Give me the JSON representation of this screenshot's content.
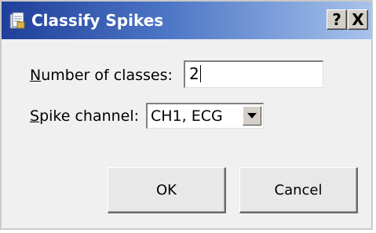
{
  "window": {
    "title": "Classify Spikes",
    "help_label": "?",
    "close_label": "X"
  },
  "form": {
    "classes_label_access": "N",
    "classes_label_rest": "umber of classes:",
    "classes_value": "2",
    "channel_label_access": "S",
    "channel_label_rest": "pike channel:",
    "channel_selected": "CH1, ECG"
  },
  "buttons": {
    "ok_label": "OK",
    "cancel_label": "Cancel"
  },
  "colors": {
    "titlebar_start": "#1f3f9a",
    "titlebar_end": "#a7c2eb",
    "dialog_bg": "#f0f0f0"
  },
  "icons": {
    "app": "document-icon",
    "dropdown": "chevron-down-icon"
  }
}
